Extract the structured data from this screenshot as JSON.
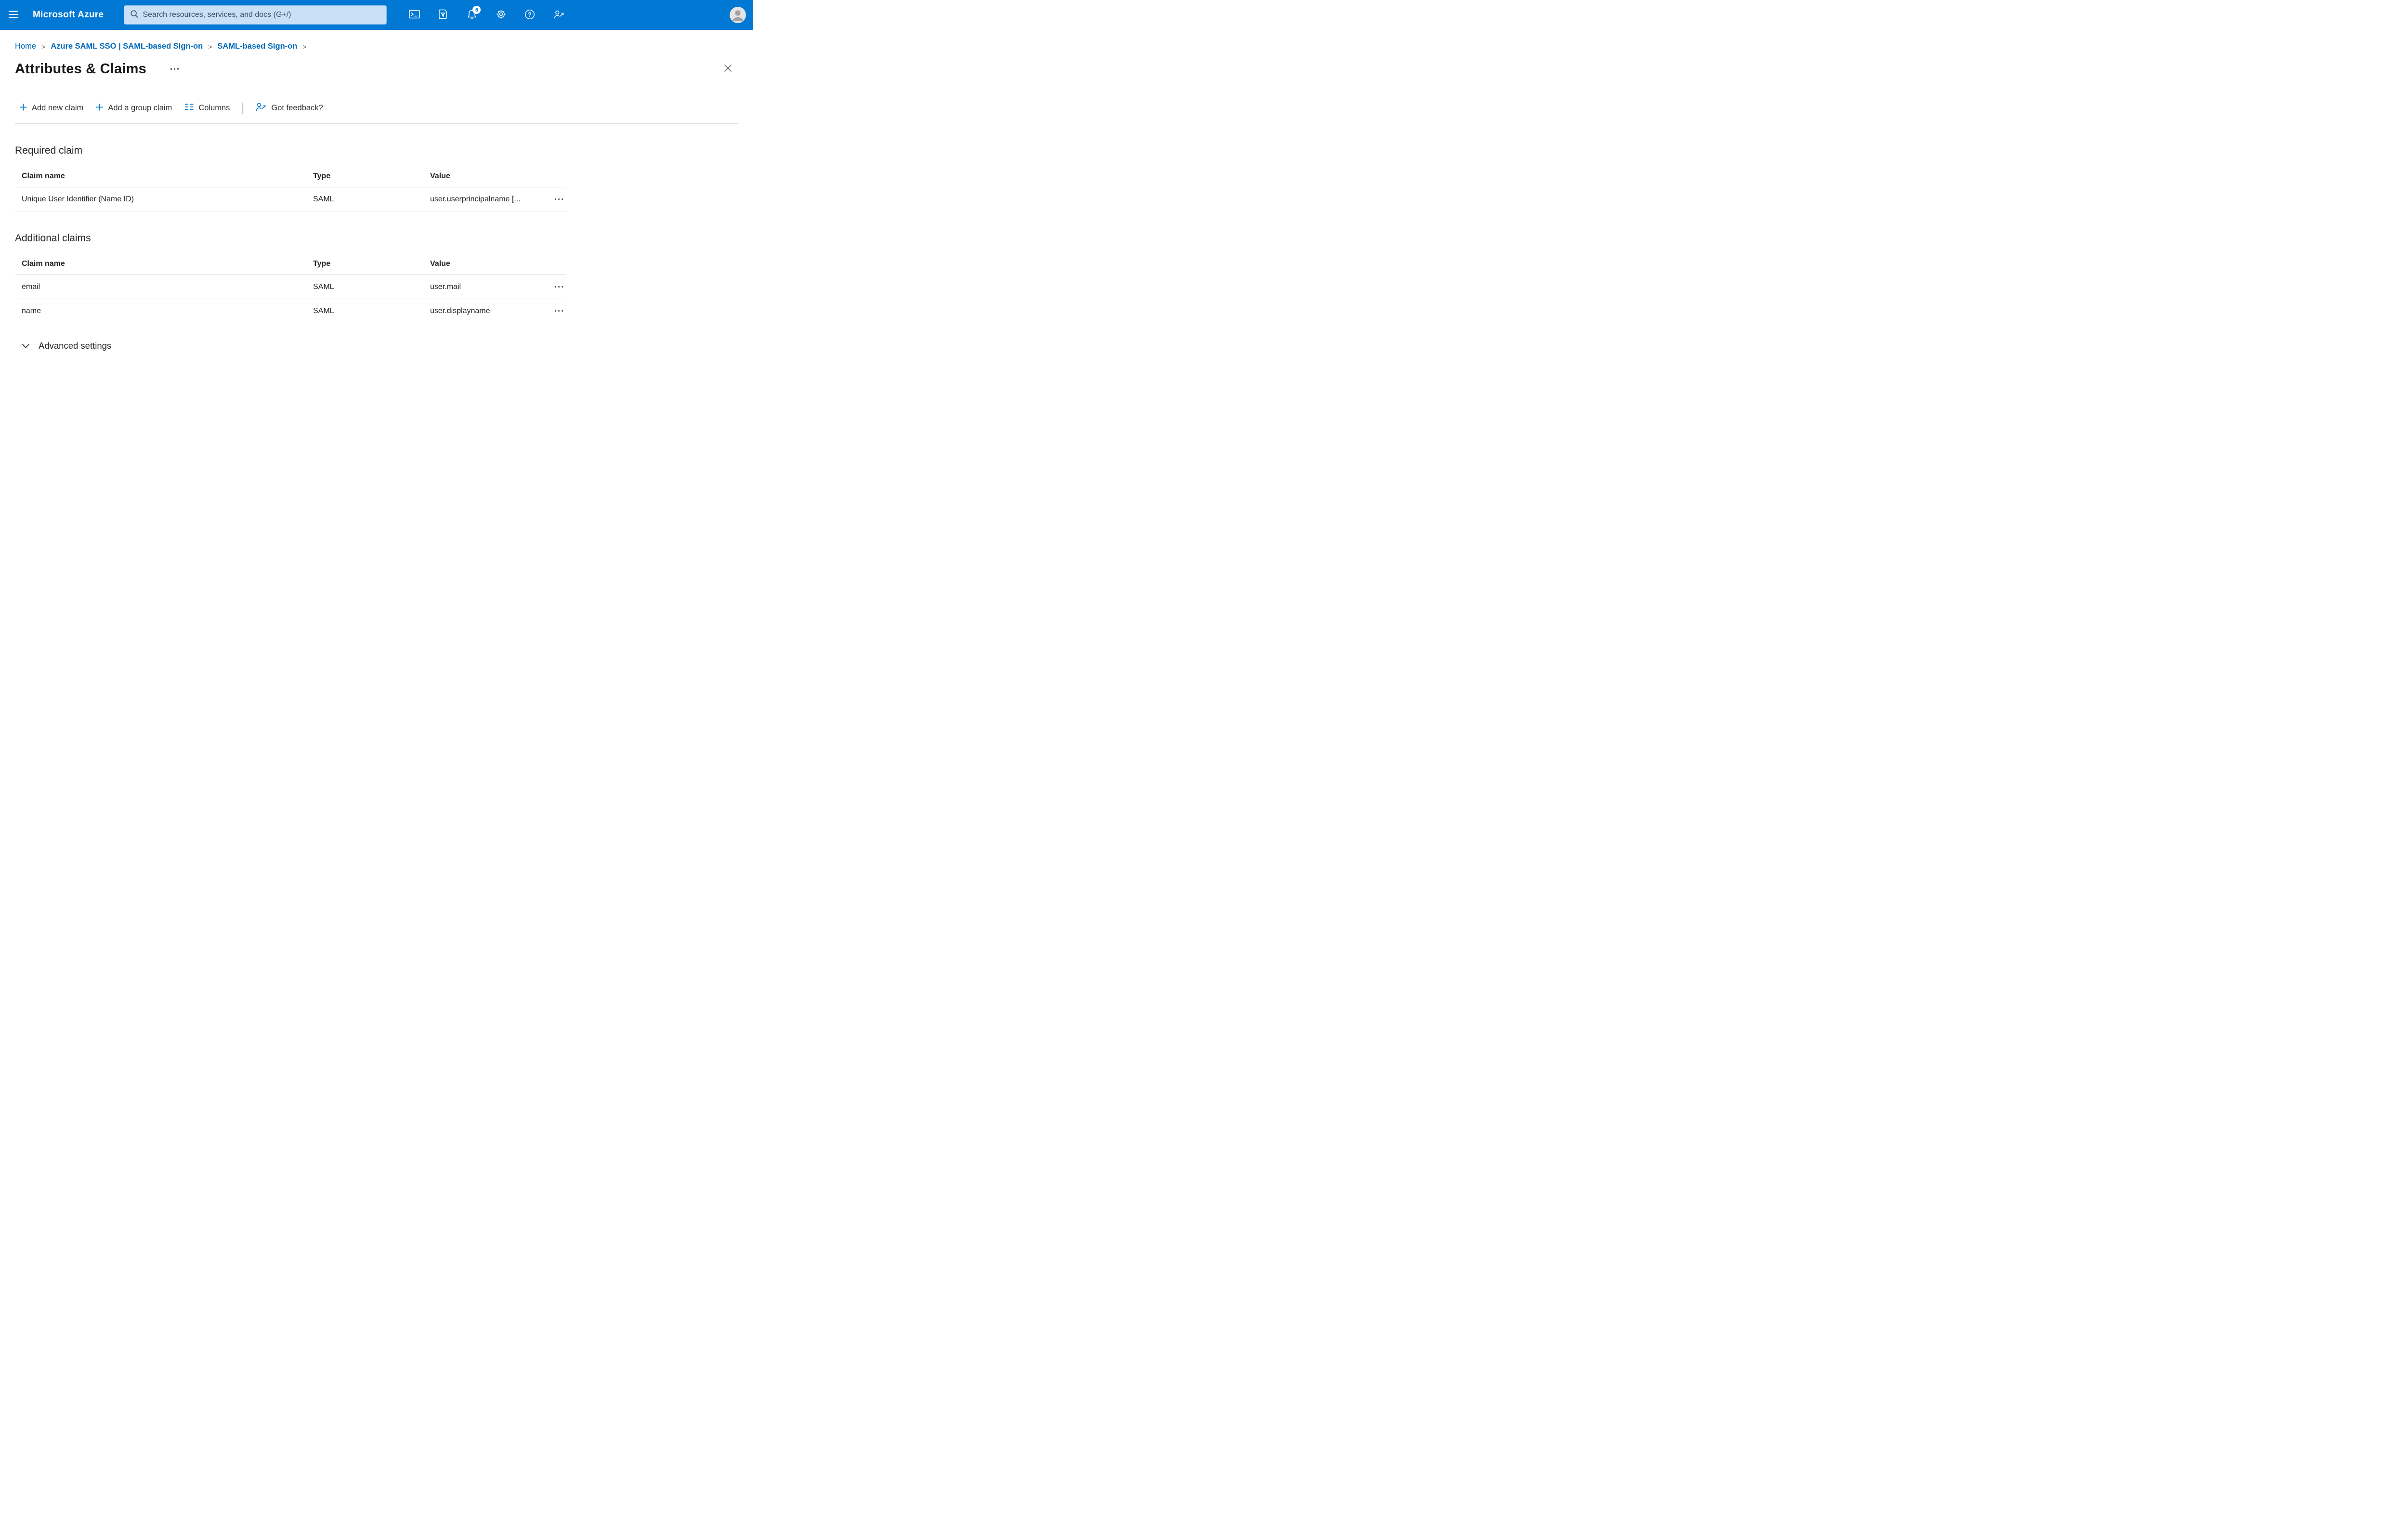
{
  "header": {
    "brand": "Microsoft Azure",
    "search_placeholder": "Search resources, services, and docs (G+/)",
    "notification_count": "6"
  },
  "icons": {
    "hamburger": "menu",
    "search": "magnifier",
    "cloud_shell": "terminal",
    "directory_filter": "document-funnel",
    "notifications": "bell",
    "settings": "gear",
    "help": "question-circle",
    "feedback": "person-arrow",
    "avatar": "person-silhouette",
    "more": "ellipsis",
    "close": "x",
    "chevron_down": "chevron-down",
    "add": "plus",
    "columns": "column-lines"
  },
  "breadcrumb": {
    "separator": ">",
    "items": [
      {
        "label": "Home"
      },
      {
        "label": "Azure SAML SSO | SAML-based Sign-on"
      },
      {
        "label": "SAML-based Sign-on"
      }
    ]
  },
  "page": {
    "title": "Attributes & Claims"
  },
  "toolbar": {
    "add_new_claim": "Add new claim",
    "add_group_claim": "Add a group claim",
    "columns": "Columns",
    "got_feedback": "Got feedback?"
  },
  "required_claim": {
    "section_title": "Required claim",
    "columns": [
      "Claim name",
      "Type",
      "Value"
    ],
    "rows": [
      {
        "claim_name": "Unique User Identifier (Name ID)",
        "type": "SAML",
        "value": "user.userprincipalname [..."
      }
    ]
  },
  "additional_claims": {
    "section_title": "Additional claims",
    "columns": [
      "Claim name",
      "Type",
      "Value"
    ],
    "rows": [
      {
        "claim_name": "email",
        "type": "SAML",
        "value": "user.mail"
      },
      {
        "claim_name": "name",
        "type": "SAML",
        "value": "user.displayname"
      }
    ]
  },
  "advanced_settings": {
    "label": "Advanced settings"
  },
  "colors": {
    "accent": "#0078d4",
    "topbar": "#0078d4",
    "link": "#0067b8"
  }
}
